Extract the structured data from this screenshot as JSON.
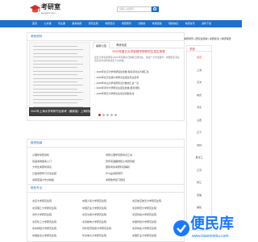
{
  "header": {
    "logo_text": "考研室",
    "logo_url": "kaoyanc.com",
    "search_placeholder": "请输入关键词"
  },
  "nav": {
    "items": [
      "首页",
      "公共课",
      "专业课",
      "报考指南",
      "研究生院",
      "考研复试",
      "考研调剂",
      "分数线",
      "考研经验",
      "院校信息",
      "考研资讯",
      "资料下载"
    ]
  },
  "section1": {
    "title": "考研资料"
  },
  "slide": {
    "caption": "2022年上海大学考研书目参考（最新版）上海财经大学考研资料（部分）"
  },
  "news": {
    "tabs": [
      "最新公告",
      "考研动态"
    ],
    "headline": "2020年复旦大学新闻学院研究生招生简章",
    "headline_desc": "复旦大学新闻学院 2020 年招收全日制硕士研究生，欢迎广大考生报考，详细招生专业目录及考试科目请见下文内容。",
    "items": [
      "2020年北京大学考研招生简章 各科目考试大纲汇总",
      "2020年北京交通大学研究生招生专业目录",
      "2020年中山大学考研复试分数线汇总一览",
      "2020年清华大学研究生招生简章 报考须知",
      "2020年南京大学研究生复试录取办法"
    ]
  },
  "sidebar": {
    "links": [
      "考研调剂 | 研究生院校 | 考研复试 | 考研真题"
    ],
    "head": "学校",
    "items": [
      "北京",
      "上海",
      "天津",
      "重庆",
      "河北",
      "山西",
      "辽宁",
      "吉林",
      "黑龙江",
      "江苏",
      "浙江",
      "安徽",
      "福建",
      "江西"
    ]
  },
  "section2": {
    "title": "报考指南"
  },
  "guide": {
    "rows": [
      [
        "心理学考研资料",
        "考研心理学真题考点汇总"
      ],
      [
        "英语考研报考入门",
        "历年英语翻译硕士考研真题"
      ],
      [
        "大学生考研时间表",
        "国际商务考研科目解析"
      ],
      [
        "日语考研学习方法总结",
        "什么是考研调剂"
      ],
      [
        "考研英语大作文模板",
        "考研数学复习规划"
      ],
      [
        "考研政治复习方法",
        "考研专业课复习攻略"
      ],
      [
        "考研院校选择技巧",
        "考研报考常见问题"
      ]
    ]
  },
  "section3": {
    "title": "院校专业"
  },
  "schools": {
    "rows": [
      [
        "北京大学研究生院",
        "中国人民大学研究生院",
        "北京航空航天大学研究生院"
      ],
      [
        "北京理工大学研究生院",
        "中国农业大学研究生院",
        "北京师范大学研究生院"
      ],
      [
        "清华大学研究生院",
        "北京交通大学研究生院",
        "北京科技大学研究生院"
      ],
      [
        "北京化工大学研究生院",
        "北京邮电大学研究生院",
        "中国传媒大学研究生院"
      ],
      [
        "中央财经大学研究生院",
        "对外经济贸易大学研究生院",
        "北京林业大学研究生院"
      ],
      [
        "中国政法大学研究生院",
        "华北电力大学研究生院",
        "中国矿业大学研究生院"
      ]
    ]
  },
  "watermark": {
    "text": "便民库",
    "url": "www.bianminku.com"
  },
  "colors": {
    "brand_blue": "#1e6fd1",
    "accent_red": "#d92b2b"
  }
}
